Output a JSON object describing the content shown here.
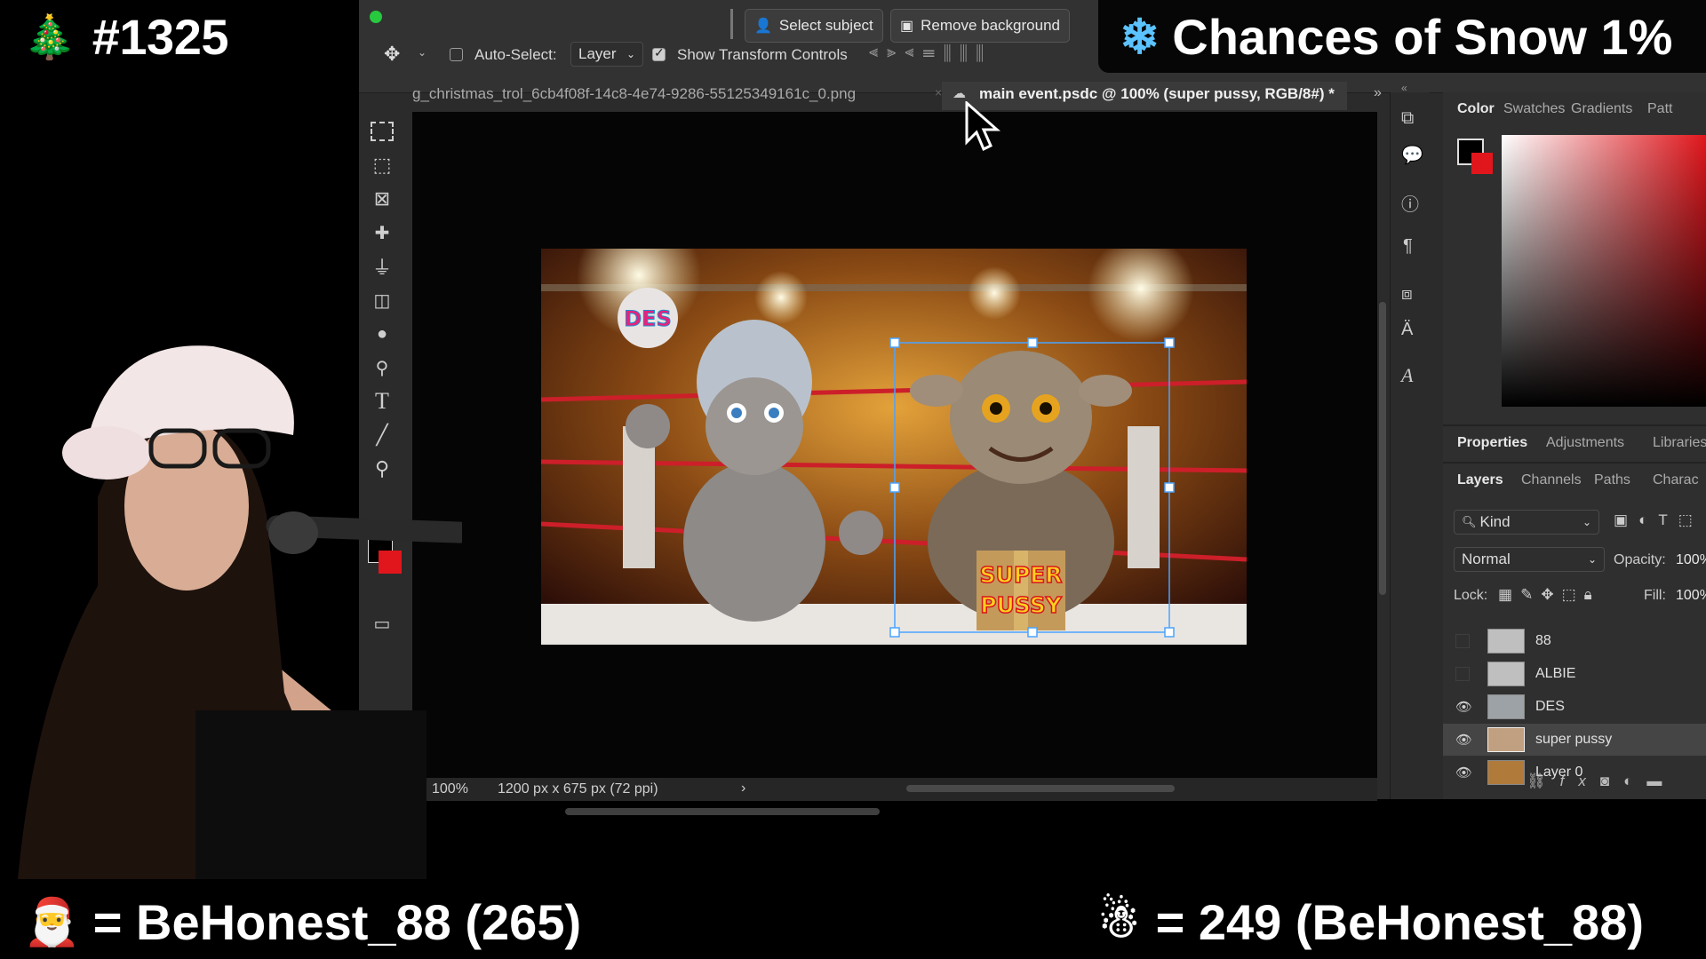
{
  "overlays": {
    "top_left": {
      "icon": "christmas-tree-icon",
      "text": "#1325"
    },
    "top_right": {
      "icon": "snowflake-icon",
      "text": "Chances of Snow 1%"
    },
    "bottom_left": {
      "icon": "santa-emoji-icon",
      "text": "= BeHonest_88 (265)"
    },
    "bottom_right": {
      "icon": "snowman-icon",
      "text": "= 249 (BeHonest_88)"
    }
  },
  "options_bar": {
    "auto_select_label": "Auto-Select:",
    "layer_dropdown": "Layer",
    "show_transform_label": "Show Transform Controls",
    "select_subject": "Select subject",
    "remove_background": "Remove background"
  },
  "tabs": {
    "inactive": "g_christmas_trol_6cb4f08f-14c8-4e74-9286-55125349161c_0.png",
    "active": "main event.psdc @ 100% (super pussy, RGB/8#) *"
  },
  "artwork": {
    "label_des": "DES",
    "label_super_1": "SUPER",
    "label_super_2": "PUSSY"
  },
  "status": {
    "zoom": "100%",
    "doc_info": "1200 px x 675 px (72 ppi)"
  },
  "color_panel": {
    "tabs": [
      "Color",
      "Swatches",
      "Gradients",
      "Patt"
    ],
    "foreground": "#000000",
    "background": "#e0161c"
  },
  "props_tabs": [
    "Properties",
    "Adjustments",
    "Libraries"
  ],
  "layers_panel": {
    "tabs": [
      "Layers",
      "Channels",
      "Paths",
      "Charac"
    ],
    "kind": "Kind",
    "blend_mode": "Normal",
    "opacity_label": "Opacity:",
    "opacity_value": "100%",
    "lock_label": "Lock:",
    "fill_label": "Fill:",
    "fill_value": "100%",
    "layers": [
      {
        "name": "88",
        "visible": false
      },
      {
        "name": "ALBIE",
        "visible": false
      },
      {
        "name": "DES",
        "visible": true
      },
      {
        "name": "super pussy",
        "visible": true,
        "selected": true
      },
      {
        "name": "Layer 0",
        "visible": true
      }
    ]
  }
}
